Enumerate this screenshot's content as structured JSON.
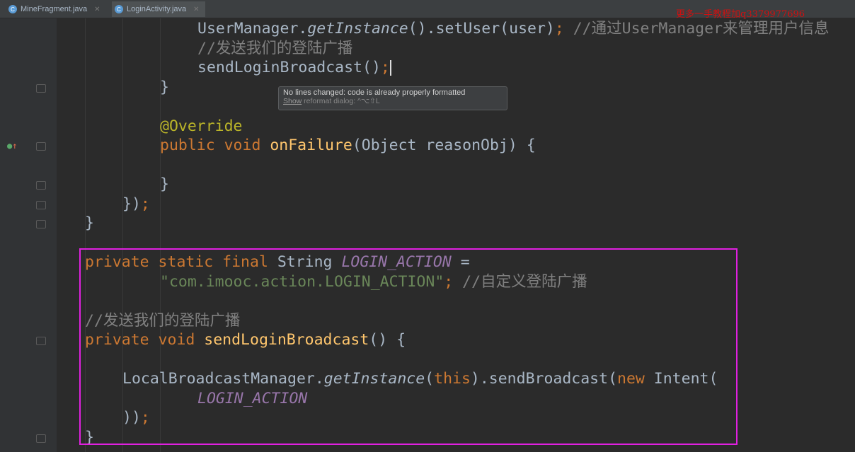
{
  "tabs": [
    {
      "label": "MineFragment.java",
      "icon": "c-class-icon"
    },
    {
      "label": "LoginActivity.java",
      "icon": "c-class-icon",
      "active": true
    }
  ],
  "watermark": "更多一手教程加q3379977696",
  "tooltip": {
    "message": "No lines changed: code is already properly formatted",
    "link": "Show",
    "rest": " reformat dialog: ^⌥⇧L"
  },
  "code_lines": [
    {
      "indent": 12,
      "tokens": [
        [
          "UserManager.",
          ""
        ],
        [
          "getInstance",
          "it"
        ],
        [
          "().setUser(user)",
          ""
        ],
        [
          ";",
          "kw"
        ],
        [
          " //通过UserManager来管理用户信息",
          "cm"
        ]
      ]
    },
    {
      "indent": 12,
      "tokens": [
        [
          "//发送我们的登陆广播",
          "cm"
        ]
      ]
    },
    {
      "indent": 12,
      "tokens": [
        [
          "sendLoginBroadcast()",
          ""
        ],
        [
          ";",
          "kw"
        ]
      ],
      "caret": true
    },
    {
      "indent": 8,
      "tokens": [
        [
          "}",
          ""
        ]
      ]
    },
    {
      "indent": 0,
      "tokens": []
    },
    {
      "indent": 8,
      "tokens": [
        [
          "@Override",
          "an"
        ]
      ]
    },
    {
      "indent": 8,
      "tokens": [
        [
          "public void ",
          "kw"
        ],
        [
          "onFailure",
          "fn"
        ],
        [
          "(Object reasonObj) {",
          ""
        ]
      ]
    },
    {
      "indent": 0,
      "tokens": []
    },
    {
      "indent": 8,
      "tokens": [
        [
          "}",
          ""
        ]
      ]
    },
    {
      "indent": 4,
      "tokens": [
        [
          "})",
          ""
        ],
        [
          ";",
          "kw"
        ]
      ]
    },
    {
      "indent": 0,
      "tokens": [
        [
          "}",
          ""
        ]
      ]
    },
    {
      "indent": 0,
      "tokens": []
    },
    {
      "indent": 0,
      "tokens": [
        [
          "private static final ",
          "kw"
        ],
        [
          "String ",
          ""
        ],
        [
          "LOGIN_ACTION",
          "st"
        ],
        [
          " =",
          ""
        ]
      ]
    },
    {
      "indent": 8,
      "tokens": [
        [
          "\"com.imooc.action.LOGIN_ACTION\"",
          "str"
        ],
        [
          ";",
          "kw"
        ],
        [
          " //自定义登陆广播",
          "cm"
        ]
      ]
    },
    {
      "indent": 0,
      "tokens": []
    },
    {
      "indent": 0,
      "tokens": [
        [
          "//发送我们的登陆广播",
          "cm"
        ]
      ]
    },
    {
      "indent": 0,
      "tokens": [
        [
          "private void ",
          "kw"
        ],
        [
          "sendLoginBroadcast",
          "fn"
        ],
        [
          "() {",
          ""
        ]
      ]
    },
    {
      "indent": 0,
      "tokens": []
    },
    {
      "indent": 4,
      "tokens": [
        [
          "LocalBroadcastManager.",
          ""
        ],
        [
          "getInstance",
          "it"
        ],
        [
          "(",
          ""
        ],
        [
          "this",
          "kw"
        ],
        [
          ").sendBroadcast(",
          ""
        ],
        [
          "new ",
          "kw"
        ],
        [
          "Intent(",
          ""
        ]
      ]
    },
    {
      "indent": 12,
      "tokens": [
        [
          "LOGIN_ACTION",
          "st"
        ]
      ]
    },
    {
      "indent": 4,
      "tokens": [
        [
          "))",
          ""
        ],
        [
          ";",
          "kw"
        ]
      ]
    },
    {
      "indent": 0,
      "tokens": [
        [
          "}",
          ""
        ]
      ]
    }
  ]
}
